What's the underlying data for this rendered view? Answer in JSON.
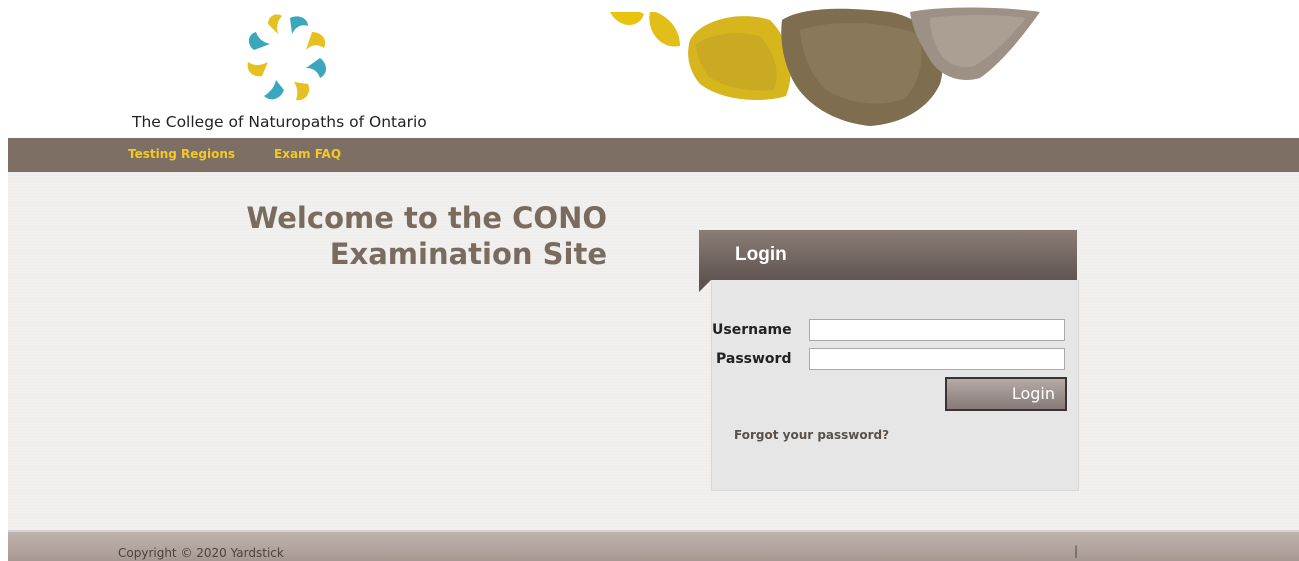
{
  "header": {
    "org_name": "The College of Naturopaths of Ontario",
    "logo_icon": "ginkgo-leaf-ring-logo",
    "banner_icon": "ginkgo-leaves-banner"
  },
  "nav": {
    "items": [
      {
        "label": "Testing Regions"
      },
      {
        "label": "Exam FAQ"
      }
    ],
    "color": "#f2c925"
  },
  "main": {
    "welcome_line1": "Welcome to the CONO",
    "welcome_line2": "Examination Site"
  },
  "login": {
    "title": "Login",
    "username_label": "Username",
    "password_label": "Password",
    "username_value": "",
    "password_value": "",
    "submit_label": "Login",
    "forgot_link": "Forgot your password?"
  },
  "footer": {
    "copyright": "Copyright © 2020 Yardstick",
    "separator": "|"
  },
  "colors": {
    "nav_bg": "#7d6f64",
    "accent": "#f2c925",
    "welcome_text": "#7a6b5f"
  }
}
